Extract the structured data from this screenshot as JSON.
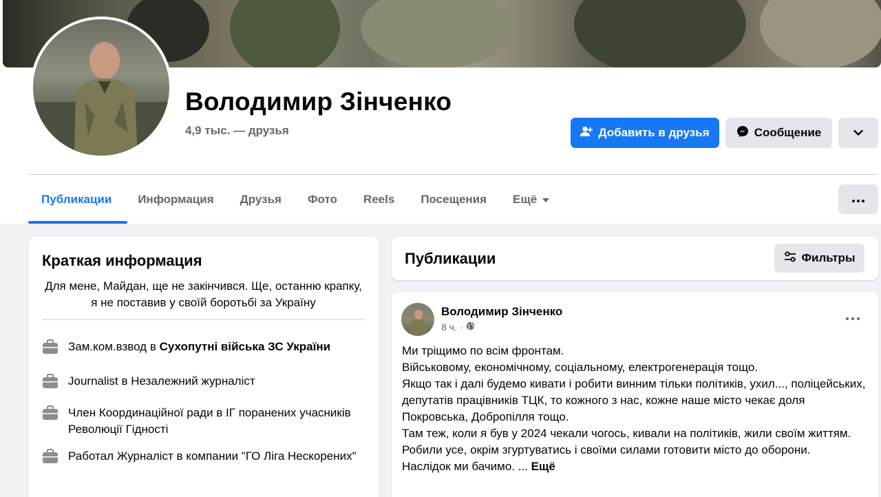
{
  "profile": {
    "name": "Володимир Зінченко",
    "friends": "4,9 тыс. — друзья"
  },
  "actions": {
    "add_friend": "Добавить в друзья",
    "message": "Сообщение"
  },
  "tabs": [
    {
      "label": "Публикации"
    },
    {
      "label": "Информация"
    },
    {
      "label": "Друзья"
    },
    {
      "label": "Фото"
    },
    {
      "label": "Reels"
    },
    {
      "label": "Посещения"
    },
    {
      "label": "Ещё"
    }
  ],
  "intro": {
    "title": "Краткая информация",
    "bio": "Для мене, Майдан, ще не закінчився. Ще, останню крапку, я не поставив у своїй боротьбі за Україну",
    "items": [
      {
        "prefix": "Зам.ком.взвод в ",
        "bold": "Сухопутні війська ЗС України"
      },
      {
        "prefix": "Journalist в Незалежний журналіст",
        "bold": ""
      },
      {
        "prefix": "Член Координаційної ради в ІГ поранених учасників Революції Гідності",
        "bold": ""
      },
      {
        "prefix": "Работал Журналіст в компании \"ГО Ліга Нескорених\"",
        "bold": ""
      }
    ]
  },
  "posts_section": {
    "title": "Публикации",
    "filters": "Фильтры"
  },
  "post": {
    "author": "Володимир Зінченко",
    "time": "8 ч.",
    "dot": "·",
    "lines": [
      "Ми тріщимо по всім фронтам.",
      "Військовому, економічному, соціальному, електрогенерація тощо.",
      "Якщо так і далі будемо кивати і робити винним тільки політиків, ухил..., поліцейських,  депутатів працівників ТЦК, то кожного з нас, кожне наше місто чекає доля Покровська, Добропілля тощо.",
      "Там теж, коли я був у 2024 чекали чогось, кивали на політиків, жили своїм життям. Робили усе, окрім згуртуватись і своїми силами готовити місто до оборони."
    ],
    "last_line": "Наслідок ми бачимо. ...",
    "see_more": "Ещё"
  },
  "icons": [
    "add-friend-icon",
    "messenger-icon",
    "chevron-down-icon",
    "dropdown-caret-icon",
    "more-dots-icon",
    "briefcase-icon",
    "filters-icon",
    "globe-icon"
  ],
  "colors": {
    "accent": "#1877f2",
    "background": "#f0f2f5",
    "secondary_button": "#e4e6eb",
    "muted_text": "#65676b"
  }
}
